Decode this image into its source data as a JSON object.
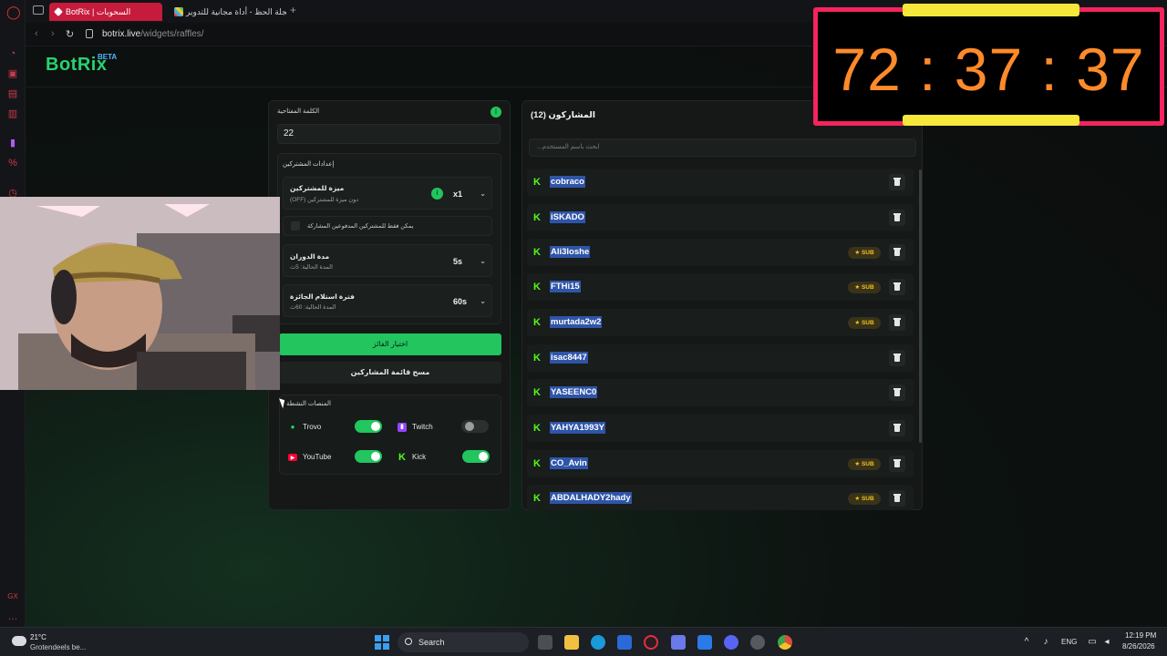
{
  "browser": {
    "tabs": [
      {
        "label": "BotRix | السحوبات",
        "active": true
      },
      {
        "label": "عجلة الحظ - أداة مجانية للتدوير",
        "active": false
      }
    ],
    "new_tab": "+",
    "url_host": "botrix.live",
    "url_path": "/widgets/raffles/"
  },
  "brand": {
    "name": "BotRix",
    "badge": "BETA"
  },
  "settings": {
    "keyword_label": "الكلمة المفتاحية",
    "keyword_value": "22",
    "subscriber_settings_title": "إعدادات المشتركين",
    "sub_perk_title": "ميزة للمشتركين",
    "sub_perk_desc": "(OFF) دون ميزة للمشتركين",
    "sub_perk_value": "x1",
    "paid_only_label": "يمكن فقط للمشتركين المدفوعين المشاركة",
    "spin_duration_title": "مدة الدوران",
    "spin_duration_desc": "المدة الحالية: 5ث",
    "spin_duration_value": "5s",
    "claim_period_title": "فترة استلام الجائزة",
    "claim_period_desc": "المدة الحالية: 60ث",
    "claim_period_value": "60s",
    "pick_winner_button": "اختيار الفائز",
    "clear_list_button": "مسح قائمة المشاركين",
    "platforms_title": "المنصات النشطة",
    "platforms": [
      {
        "name": "Trovo",
        "enabled": true
      },
      {
        "name": "Twitch",
        "enabled": false
      },
      {
        "name": "YouTube",
        "enabled": true
      },
      {
        "name": "Kick",
        "enabled": true
      }
    ]
  },
  "participants": {
    "title": "المشاركون (12)",
    "search_placeholder": "...ابحث باسم المستخدم",
    "sub_badge": "★ SUB",
    "list": [
      {
        "name": "cobraco",
        "sub": false
      },
      {
        "name": "iSKADO",
        "sub": false
      },
      {
        "name": "Ali3loshe",
        "sub": true
      },
      {
        "name": "FTHi15",
        "sub": true
      },
      {
        "name": "murtada2w2",
        "sub": true
      },
      {
        "name": "isac8447",
        "sub": false
      },
      {
        "name": "YASEENC0",
        "sub": false
      },
      {
        "name": "YAHYA1993Y",
        "sub": false
      },
      {
        "name": "CO_Avin",
        "sub": true
      },
      {
        "name": "ABDALHADY2hady",
        "sub": true
      }
    ]
  },
  "timer": {
    "text": "72 : 37 : 37"
  },
  "taskbar": {
    "temperature": "21°C",
    "weather_desc": "Grotendeels be...",
    "search_label": "Search",
    "language": "ENG",
    "time": "12:19 PM",
    "date": "8/26/2026"
  },
  "colors": {
    "accent_green": "#22c55e",
    "kick_green": "#53fc18",
    "timer_orange": "#ff8a2a",
    "timer_border": "#f4245f",
    "tab_active": "#c61b3c"
  }
}
